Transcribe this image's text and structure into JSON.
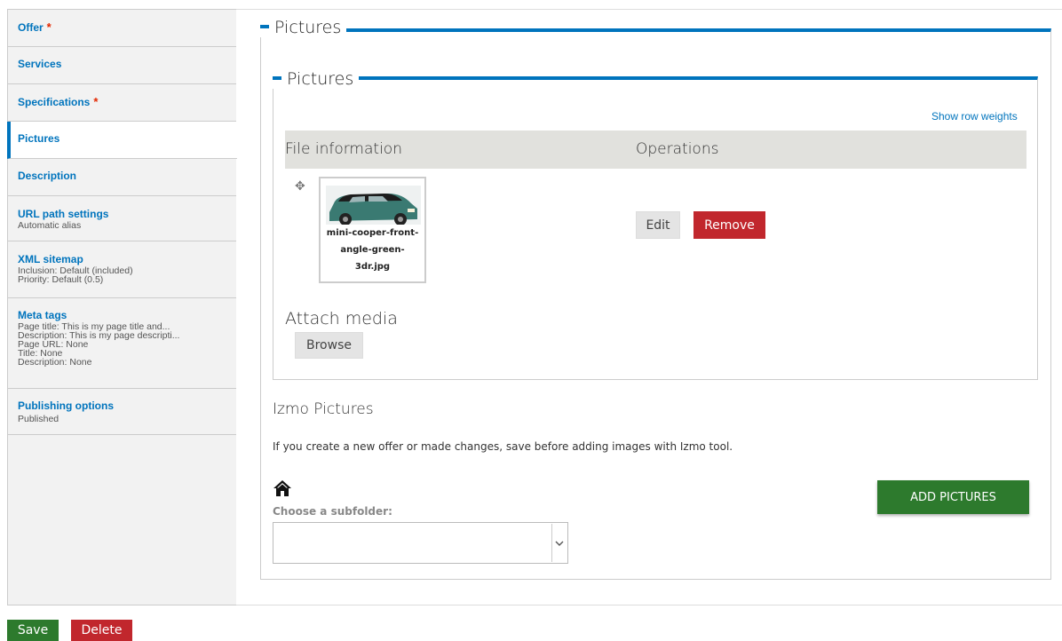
{
  "sidebar": {
    "tabs": [
      {
        "title": "Offer",
        "required": "*",
        "summary": []
      },
      {
        "title": "Services",
        "required": "",
        "summary": []
      },
      {
        "title": "Specifications",
        "required": "*",
        "summary": []
      },
      {
        "title": "Pictures",
        "required": "",
        "summary": []
      },
      {
        "title": "Description",
        "required": "",
        "summary": []
      },
      {
        "title": "URL path settings",
        "required": "",
        "summary": [
          "Automatic alias"
        ]
      },
      {
        "title": "XML sitemap",
        "required": "",
        "summary": [
          "Inclusion: Default (included)",
          "Priority: Default (0.5)"
        ]
      },
      {
        "title": "Meta tags",
        "required": "",
        "summary": [
          "Page title: This is my page title and...",
          "Description: This is my page descripti...",
          "Page URL: None",
          "Title: None",
          "Description: None"
        ]
      },
      {
        "title": "Publishing options",
        "required": "",
        "summary": [
          "Published"
        ]
      }
    ]
  },
  "main": {
    "outer_legend": "Pictures",
    "inner_legend": "Pictures",
    "show_row_weights": "Show row weights",
    "table": {
      "headers": [
        "File information",
        "Operations"
      ],
      "rows": [
        {
          "file_name": "mini-cooper-front-angle-green-3dr.jpg",
          "file_name_lines": [
            "mini-cooper-front-",
            "angle-green-",
            "3dr.jpg"
          ],
          "edit": "Edit",
          "remove": "Remove"
        }
      ]
    },
    "attach_media": "Attach media",
    "browse": "Browse",
    "izmo": {
      "title": "Izmo Pictures",
      "notice": "If you create a new offer or made changes, save before adding images with Izmo tool.",
      "home_icon": "home-icon",
      "subfolder_label": "Choose a subfolder:",
      "subfolder_value": "",
      "add_button": "ADD PICTURES"
    }
  },
  "actions": {
    "save": "Save",
    "delete": "Delete"
  },
  "colors": {
    "accent": "#0074bd",
    "danger": "#c1272d",
    "success": "#2d7a2d",
    "required": "#e32700"
  }
}
